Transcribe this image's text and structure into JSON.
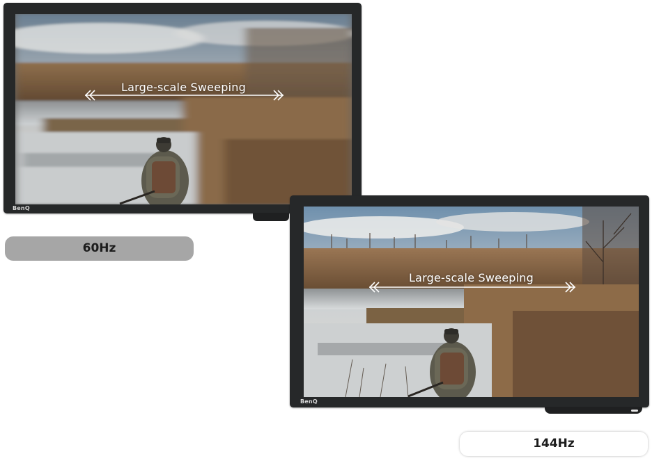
{
  "panels": [
    {
      "id": "60hz",
      "brand_logo": "BenQ",
      "overlay_label": "Large-scale Sweeping",
      "arrow_icon": "double-chevron-arrows-icon",
      "refresh_rate_label": "60Hz",
      "image_state": "motion-blurred"
    },
    {
      "id": "144hz",
      "brand_logo": "BenQ",
      "overlay_label": "Large-scale Sweeping",
      "arrow_icon": "double-chevron-arrows-icon",
      "refresh_rate_label": "144Hz",
      "image_state": "sharp"
    }
  ],
  "colors": {
    "pill_60_background": "#a6a6a6",
    "pill_144_background": "#ffffff",
    "bezel": "#262829",
    "label_text": "#1d1d1d"
  }
}
